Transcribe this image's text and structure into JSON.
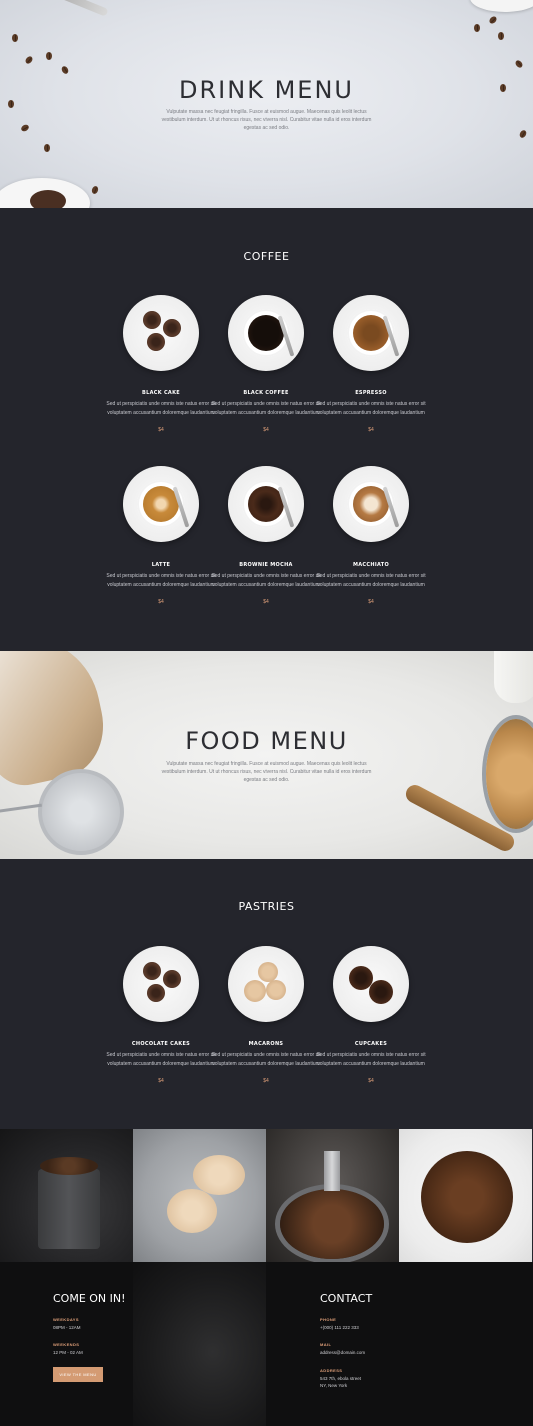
{
  "drink_hero": {
    "title": "DRINK MENU",
    "text": "Vulputate massa nec feugiat fringilla. Fusce at euismod augue. Maecenas quis leolit lectus vestibulum interdum. Ut ut rhoncus risus, nec viverra nisl. Curabitur vitae nulla id eros interdum egestas ac sed odio."
  },
  "coffee": {
    "title": "COFFEE",
    "items": [
      {
        "name": "BLACK CAKE",
        "desc": "Sed ut perspiciatis unde omnis iste natus error sit voluptatem accusantium doloremque laudantium",
        "price": "$4"
      },
      {
        "name": "BLACK COFFEE",
        "desc": "Sed ut perspiciatis unde omnis iste natus error sit voluptatem accusantium doloremque laudantium",
        "price": "$4"
      },
      {
        "name": "ESPRESSO",
        "desc": "Sed ut perspiciatis unde omnis iste natus error sit voluptatem accusantium doloremque laudantium",
        "price": "$4"
      },
      {
        "name": "LATTE",
        "desc": "Sed ut perspiciatis unde omnis iste natus error sit voluptatem accusantium doloremque laudantium",
        "price": "$4"
      },
      {
        "name": "BROWNIE MOCHA",
        "desc": "Sed ut perspiciatis unde omnis iste natus error sit voluptatem accusantium doloremque laudantium",
        "price": "$4"
      },
      {
        "name": "MACCHIATO",
        "desc": "Sed ut perspiciatis unde omnis iste natus error sit voluptatem accusantium doloremque laudantium",
        "price": "$4"
      }
    ]
  },
  "food_hero": {
    "title": "FOOD MENU",
    "text": "Vulputate massa nec feugiat fringilla. Fusce at euismod augue. Maecenas quis leolit lectus vestibulum interdum. Ut ut rhoncus risus, nec viverra nisl. Curabitur vitae nulla id eros interdum egestas ac sed odio."
  },
  "pastries": {
    "title": "PASTRIES",
    "items": [
      {
        "name": "CHOCOLATE CAKES",
        "desc": "Sed ut perspiciatis unde omnis iste natus error sit voluptatem accusantium doloremque laudantium",
        "price": "$4"
      },
      {
        "name": "MACARONS",
        "desc": "Sed ut perspiciatis unde omnis iste natus error sit voluptatem accusantium doloremque laudantium",
        "price": "$4"
      },
      {
        "name": "CUPCAKES",
        "desc": "Sed ut perspiciatis unde omnis iste natus error sit voluptatem accusantium doloremque laudantium",
        "price": "$4"
      }
    ]
  },
  "footer": {
    "come_title": "COME ON IN!",
    "weekdays_label": "WEEKDAYS",
    "weekdays_value": "08PM - 12AM",
    "weekends_label": "WEEKENDS",
    "weekends_value": "12 PM - 02 AM",
    "menu_button": "VIEW THE MENU",
    "contact_title": "CONTACT",
    "phone_label": "PHONE",
    "phone_value": "+(000) 111 222 333",
    "mail_label": "MAIL",
    "mail_value": "address@domain.com",
    "address_label": "ADDRESS",
    "address_line1": "543 7th, ebola street",
    "address_line2": "NY, New York"
  },
  "colors": {
    "dark_bg": "#24252c",
    "accent": "#e0a07a",
    "button": "#d49b73"
  }
}
